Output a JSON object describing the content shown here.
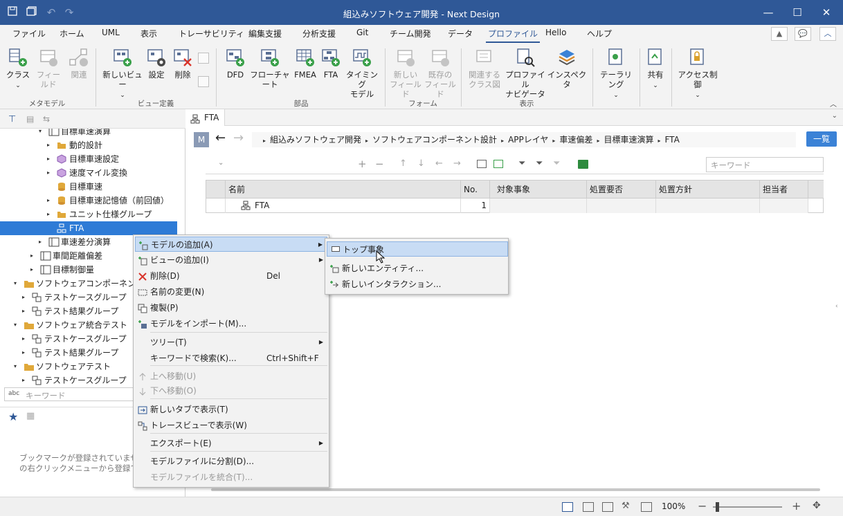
{
  "window": {
    "title": "組込みソフトウェア開発 - Next Design"
  },
  "menu": {
    "items": [
      "ファイル",
      "ホーム",
      "UML",
      "表示",
      "トレーサビリティ",
      "編集支援",
      "分析支援",
      "Git",
      "チーム開発",
      "データ",
      "プロファイル",
      "Hello",
      "ヘルプ"
    ],
    "active_index": 10
  },
  "ribbon": {
    "buttons": [
      {
        "l1": "クラス",
        "l2": "",
        "dis": false
      },
      {
        "l1": "フィールド",
        "l2": "",
        "dis": true
      },
      {
        "l1": "関連",
        "l2": "",
        "dis": true
      },
      {
        "l1": "新しいビュー",
        "l2": "",
        "dis": false
      },
      {
        "l1": "設定",
        "l2": "",
        "dis": false
      },
      {
        "l1": "削除",
        "l2": "",
        "dis": false
      },
      {
        "l1": "DFD",
        "l2": "",
        "dis": false
      },
      {
        "l1": "フローチャート",
        "l2": "",
        "dis": false
      },
      {
        "l1": "FMEA",
        "l2": "",
        "dis": false
      },
      {
        "l1": "FTA",
        "l2": "",
        "dis": false
      },
      {
        "l1": "タイミング",
        "l2": "モデル",
        "dis": false
      },
      {
        "l1": "新しい",
        "l2": "フィールド",
        "dis": true
      },
      {
        "l1": "既存の",
        "l2": "フィールド",
        "dis": true
      },
      {
        "l1": "関連する",
        "l2": "クラス図",
        "dis": true
      },
      {
        "l1": "プロファイル",
        "l2": "ナビゲータ",
        "dis": false
      },
      {
        "l1": "インスペクタ",
        "l2": "",
        "dis": false
      },
      {
        "l1": "テーラリング",
        "l2": "",
        "dis": false
      },
      {
        "l1": "共有",
        "l2": "",
        "dis": false
      },
      {
        "l1": "アクセス制御",
        "l2": "",
        "dis": false
      }
    ],
    "groups": [
      "メタモデル",
      "ビュー定義",
      "部品",
      "フォーム",
      "表示"
    ]
  },
  "tree": {
    "items": [
      {
        "label": "目標車速演算",
        "indent": 4,
        "arrow": "▾",
        "selected": false
      },
      {
        "label": "動的設計",
        "indent": 5,
        "arrow": "▸",
        "selected": false
      },
      {
        "label": "目標車速設定",
        "indent": 5,
        "arrow": "▸",
        "selected": false
      },
      {
        "label": "速度マイル変換",
        "indent": 5,
        "arrow": "▸",
        "selected": false
      },
      {
        "label": "目標車速",
        "indent": 5,
        "arrow": "",
        "selected": false
      },
      {
        "label": "目標車速記憶値（前回値）",
        "indent": 5,
        "arrow": "▸",
        "selected": false
      },
      {
        "label": "ユニット仕様グループ",
        "indent": 5,
        "arrow": "▸",
        "selected": false
      },
      {
        "label": "FTA",
        "indent": 5,
        "arrow": "",
        "selected": true
      },
      {
        "label": "車速差分演算",
        "indent": 4,
        "arrow": "▸",
        "selected": false
      },
      {
        "label": "車間距離偏差",
        "indent": 3,
        "arrow": "▸",
        "selected": false
      },
      {
        "label": "目標制御量",
        "indent": 3,
        "arrow": "▸",
        "selected": false
      },
      {
        "label": "ソフトウェアコンポーネントテスト",
        "indent": 1,
        "arrow": "▾",
        "selected": false
      },
      {
        "label": "テストケースグループ",
        "indent": 2,
        "arrow": "▸",
        "selected": false
      },
      {
        "label": "テスト結果グループ",
        "indent": 2,
        "arrow": "▸",
        "selected": false
      },
      {
        "label": "ソフトウェア統合テスト",
        "indent": 1,
        "arrow": "▾",
        "selected": false
      },
      {
        "label": "テストケースグループ",
        "indent": 2,
        "arrow": "▸",
        "selected": false
      },
      {
        "label": "テスト結果グループ",
        "indent": 2,
        "arrow": "▸",
        "selected": false
      },
      {
        "label": "ソフトウェアテスト",
        "indent": 1,
        "arrow": "▾",
        "selected": false
      },
      {
        "label": "テストケースグループ",
        "indent": 2,
        "arrow": "▸",
        "selected": false
      }
    ],
    "search_placeholder": "キーワード",
    "bookmark_msg_1": "ブックマークが登録されていません。",
    "bookmark_msg_2": "の右クリックメニューから登録できます"
  },
  "editor": {
    "tab": "FTA",
    "badge": "M",
    "breadcrumb": [
      "組込みソフトウェア開発",
      "ソフトウェアコンポーネント設計",
      "APPレイヤ",
      "車速偏差",
      "目標車速演算",
      "FTA"
    ],
    "list_button": "一覧",
    "search_placeholder": "キーワード",
    "columns": [
      "名前",
      "No.",
      "対象事象",
      "処置要否",
      "処置方針",
      "担当者"
    ],
    "rows": [
      {
        "name": "FTA",
        "no": "1"
      }
    ]
  },
  "context_menu": {
    "items": [
      {
        "label": "モデルの追加(A)",
        "key": "",
        "sub": true,
        "dis": false,
        "hl": true
      },
      {
        "label": "ビューの追加(I)",
        "key": "",
        "sub": true,
        "dis": false,
        "hl": false
      },
      {
        "label": "削除(D)",
        "key": "Del",
        "sub": false,
        "dis": false,
        "hl": false
      },
      {
        "label": "名前の変更(N)",
        "key": "",
        "sub": false,
        "dis": false,
        "hl": false
      },
      {
        "label": "複製(P)",
        "key": "",
        "sub": false,
        "dis": false,
        "hl": false
      },
      {
        "label": "モデルをインポート(M)...",
        "key": "",
        "sub": false,
        "dis": false,
        "hl": false
      },
      {
        "label": "ツリー(T)",
        "key": "",
        "sub": true,
        "dis": false,
        "hl": false
      },
      {
        "label": "キーワードで検索(K)...",
        "key": "Ctrl+Shift+F",
        "sub": false,
        "dis": false,
        "hl": false
      },
      {
        "label": "上へ移動(U)",
        "key": "",
        "sub": false,
        "dis": true,
        "hl": false
      },
      {
        "label": "下へ移動(O)",
        "key": "",
        "sub": false,
        "dis": true,
        "hl": false
      },
      {
        "label": "新しいタブで表示(T)",
        "key": "",
        "sub": false,
        "dis": false,
        "hl": false
      },
      {
        "label": "トレースビューで表示(W)",
        "key": "",
        "sub": false,
        "dis": false,
        "hl": false
      },
      {
        "label": "エクスポート(E)",
        "key": "",
        "sub": true,
        "dis": false,
        "hl": false
      },
      {
        "label": "モデルファイルに分割(D)...",
        "key": "",
        "sub": false,
        "dis": false,
        "hl": false
      },
      {
        "label": "モデルファイルを統合(T)...",
        "key": "",
        "sub": false,
        "dis": true,
        "hl": false
      }
    ],
    "submenu": [
      "トップ事象",
      "新しいエンティティ...",
      "新しいインタラクション..."
    ]
  },
  "status": {
    "zoom": "100%"
  }
}
